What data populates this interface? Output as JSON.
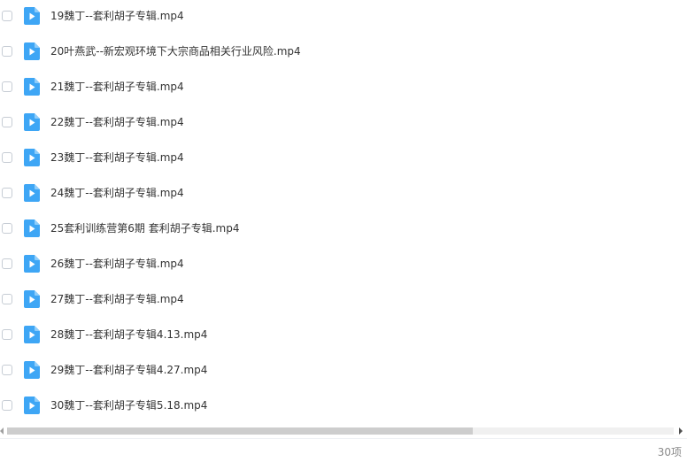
{
  "files": [
    {
      "name": "19魏丁--套利胡子专辑.mp4",
      "icon": "video-file-icon"
    },
    {
      "name": "20叶燕武--新宏观环境下大宗商品相关行业风险.mp4",
      "icon": "video-file-icon"
    },
    {
      "name": "21魏丁--套利胡子专辑.mp4",
      "icon": "video-file-icon"
    },
    {
      "name": "22魏丁--套利胡子专辑.mp4",
      "icon": "video-file-icon"
    },
    {
      "name": "23魏丁--套利胡子专辑.mp4",
      "icon": "video-file-icon"
    },
    {
      "name": "24魏丁--套利胡子专辑.mp4",
      "icon": "video-file-icon"
    },
    {
      "name": "25套利训练营第6期   套利胡子专辑.mp4",
      "icon": "video-file-icon"
    },
    {
      "name": "26魏丁--套利胡子专辑.mp4",
      "icon": "video-file-icon"
    },
    {
      "name": "27魏丁--套利胡子专辑.mp4",
      "icon": "video-file-icon"
    },
    {
      "name": "28魏丁--套利胡子专辑4.13.mp4",
      "icon": "video-file-icon"
    },
    {
      "name": "29魏丁--套利胡子专辑4.27.mp4",
      "icon": "video-file-icon"
    },
    {
      "name": "30魏丁--套利胡子专辑5.18.mp4",
      "icon": "video-file-icon"
    }
  ],
  "footer": {
    "item_count": "30项"
  },
  "colors": {
    "icon_blue": "#3ea6f5",
    "text": "#333333",
    "count_text": "#8a8a8a"
  }
}
